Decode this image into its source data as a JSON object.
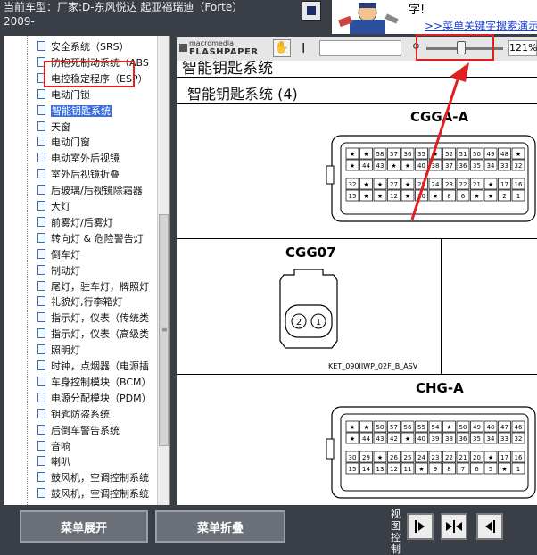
{
  "header": {
    "title": "当前车型：厂家:D-东风悦达 起亚福瑞迪（Forte）",
    "year": "2009-"
  },
  "banner": {
    "char": "字!",
    "link_text": ">>菜单关键字搜索演示"
  },
  "sidebar": {
    "items": [
      {
        "label": "安全系统（SRS）"
      },
      {
        "label": "防抱死制动系统（ABS"
      },
      {
        "label": "电控稳定程序（ESP）"
      },
      {
        "label": "电动门锁"
      },
      {
        "label": "智能钥匙系统",
        "selected": true,
        "highlight": "智能"
      },
      {
        "label": "天窗"
      },
      {
        "label": "电动门窗"
      },
      {
        "label": "电动室外后视镜"
      },
      {
        "label": "室外后视镜折叠"
      },
      {
        "label": "后玻璃/后视镜除霜器"
      },
      {
        "label": "大灯"
      },
      {
        "label": "前雾灯/后雾灯"
      },
      {
        "label": "转向灯 & 危险警告灯"
      },
      {
        "label": "倒车灯"
      },
      {
        "label": "制动灯"
      },
      {
        "label": "尾灯，驻车灯，牌照灯"
      },
      {
        "label": "礼貌灯,行李箱灯"
      },
      {
        "label": "指示灯，仪表（传统类"
      },
      {
        "label": "指示灯，仪表（高级类"
      },
      {
        "label": "照明灯"
      },
      {
        "label": "时钟，点烟器（电源插"
      },
      {
        "label": "车身控制模块（BCM）"
      },
      {
        "label": "电源分配模块（PDM）"
      },
      {
        "label": "钥匙防盗系统"
      },
      {
        "label": "后倒车警告系统"
      },
      {
        "label": "音响"
      },
      {
        "label": "喇叭"
      },
      {
        "label": "鼓风机，空调控制系统"
      },
      {
        "label": "鼓风机，空调控制系统"
      }
    ]
  },
  "toolbar": {
    "logo_top": "macromedia",
    "logo_bottom": "FLASHPAPER",
    "cursor_glyph": "I",
    "zoom_value": "121%",
    "zoom_level_percent": 121
  },
  "document": {
    "cut_title": "智能钥匙系统",
    "title": "智能钥匙系统 (4)",
    "connectors": {
      "top": "CGGA-A",
      "middle": "CGG07",
      "middle_sub": "KET_090IIWP_02F_B_ASV",
      "bottom": "CHG-A"
    },
    "pin_labels": [
      "2",
      "1"
    ],
    "top_rows": [
      [
        "★",
        "★",
        "58",
        "57",
        "36",
        "35",
        "★",
        "52",
        "51",
        "50",
        "49",
        "48",
        "★"
      ],
      [
        "★",
        "44",
        "43",
        "★",
        "★",
        "40",
        "38",
        "37",
        "36",
        "35",
        "34",
        "33",
        "32"
      ],
      [
        "32",
        "★",
        "★",
        "27",
        "★",
        "25",
        "24",
        "23",
        "22",
        "21",
        "★",
        "17",
        "16"
      ],
      [
        "15",
        "★",
        "★",
        "12",
        "★",
        "10",
        "★",
        "8",
        "6",
        "★",
        "★",
        "2",
        "1"
      ]
    ],
    "bottom_rows": [
      [
        "★",
        "★",
        "58",
        "57",
        "56",
        "55",
        "54",
        "★",
        "50",
        "49",
        "48",
        "47",
        "46"
      ],
      [
        "★",
        "44",
        "43",
        "42",
        "★",
        "40",
        "39",
        "38",
        "36",
        "35",
        "34",
        "33",
        "32"
      ],
      [
        "30",
        "29",
        "★",
        "26",
        "25",
        "24",
        "23",
        "22",
        "21",
        "20",
        "★",
        "17",
        "16"
      ],
      [
        "15",
        "14",
        "13",
        "12",
        "11",
        "★",
        "9",
        "8",
        "7",
        "6",
        "5",
        "★",
        "1"
      ]
    ]
  },
  "bottom": {
    "expand_label": "菜单展开",
    "collapse_label": "菜单折叠",
    "view_label": "视图控制"
  },
  "colors": {
    "chrome": "#3a3f47",
    "annotation": "#e02020",
    "selection": "#3a6fe0",
    "link": "#1a3fd6"
  }
}
